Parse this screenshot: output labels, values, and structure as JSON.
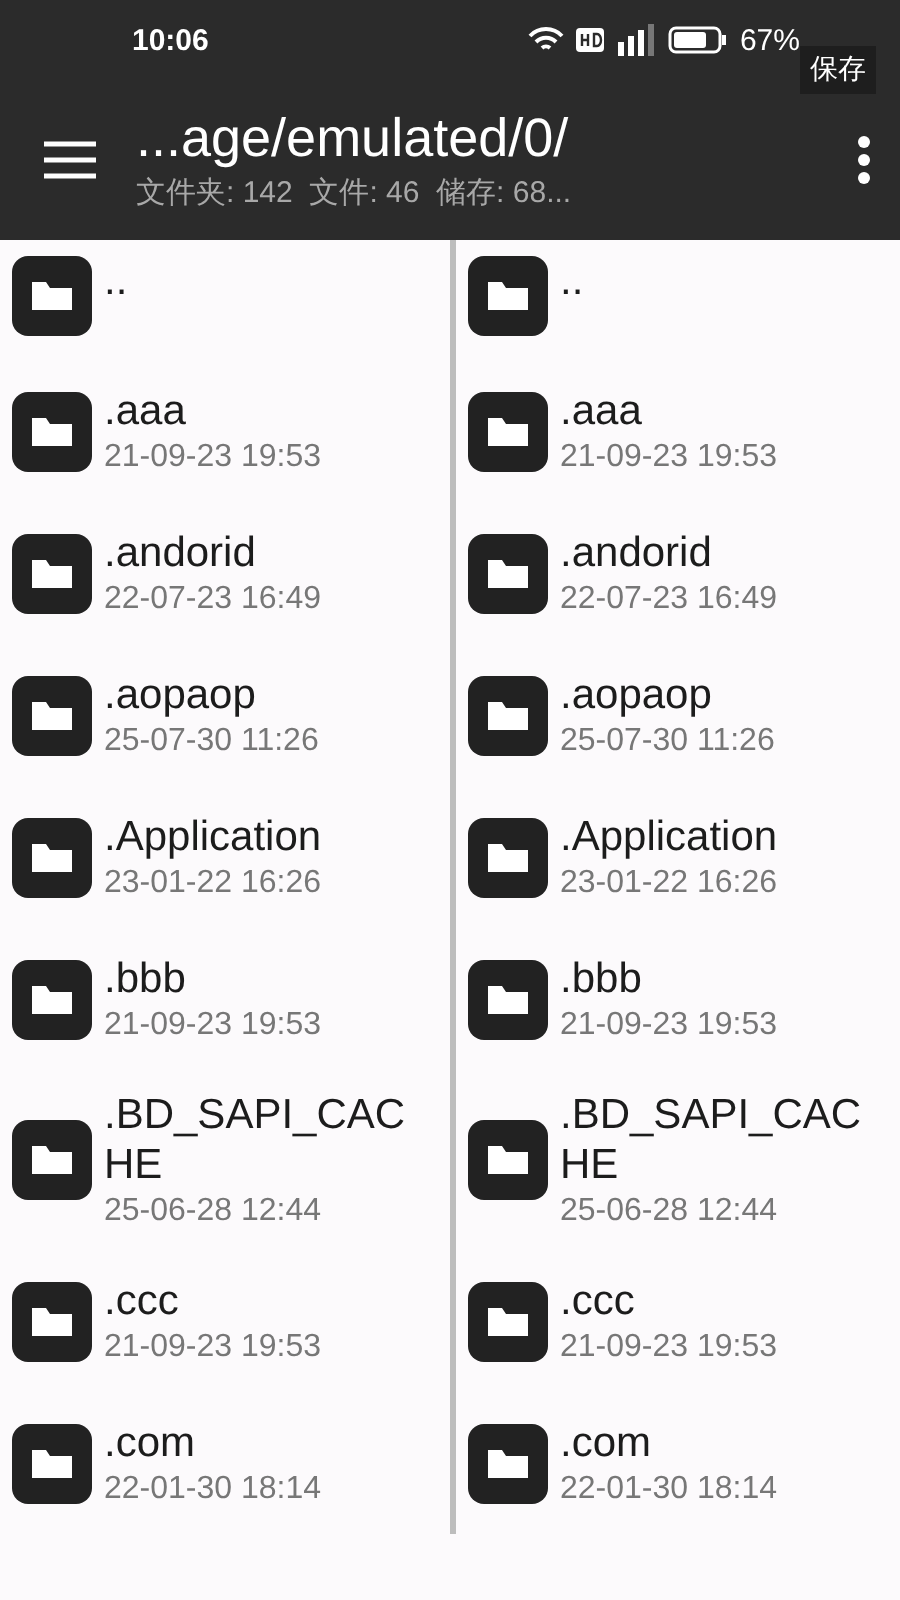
{
  "status_bar": {
    "time": "10:06",
    "battery": "67%"
  },
  "save_button": {
    "label": "保存"
  },
  "toolbar": {
    "path": "...age/emulated/0/",
    "summary": "文件夹: 142  文件: 46  储存: 68..."
  },
  "panes": [
    {
      "items": [
        {
          "name": ".."
        },
        {
          "name": ".aaa",
          "date": "21-09-23 19:53"
        },
        {
          "name": ".andorid",
          "date": "22-07-23 16:49"
        },
        {
          "name": ".aopaop",
          "date": "25-07-30 11:26"
        },
        {
          "name": ".Application",
          "date": "23-01-22 16:26"
        },
        {
          "name": ".bbb",
          "date": "21-09-23 19:53"
        },
        {
          "name": ".BD_SAPI_CACHE",
          "date": "25-06-28 12:44"
        },
        {
          "name": ".ccc",
          "date": "21-09-23 19:53"
        },
        {
          "name": ".com",
          "date": "22-01-30 18:14"
        }
      ]
    },
    {
      "items": [
        {
          "name": ".."
        },
        {
          "name": ".aaa",
          "date": "21-09-23 19:53"
        },
        {
          "name": ".andorid",
          "date": "22-07-23 16:49"
        },
        {
          "name": ".aopaop",
          "date": "25-07-30 11:26"
        },
        {
          "name": ".Application",
          "date": "23-01-22 16:26"
        },
        {
          "name": ".bbb",
          "date": "21-09-23 19:53"
        },
        {
          "name": ".BD_SAPI_CACHE",
          "date": "25-06-28 12:44"
        },
        {
          "name": ".ccc",
          "date": "21-09-23 19:53"
        },
        {
          "name": ".com",
          "date": "22-01-30 18:14"
        }
      ]
    }
  ]
}
